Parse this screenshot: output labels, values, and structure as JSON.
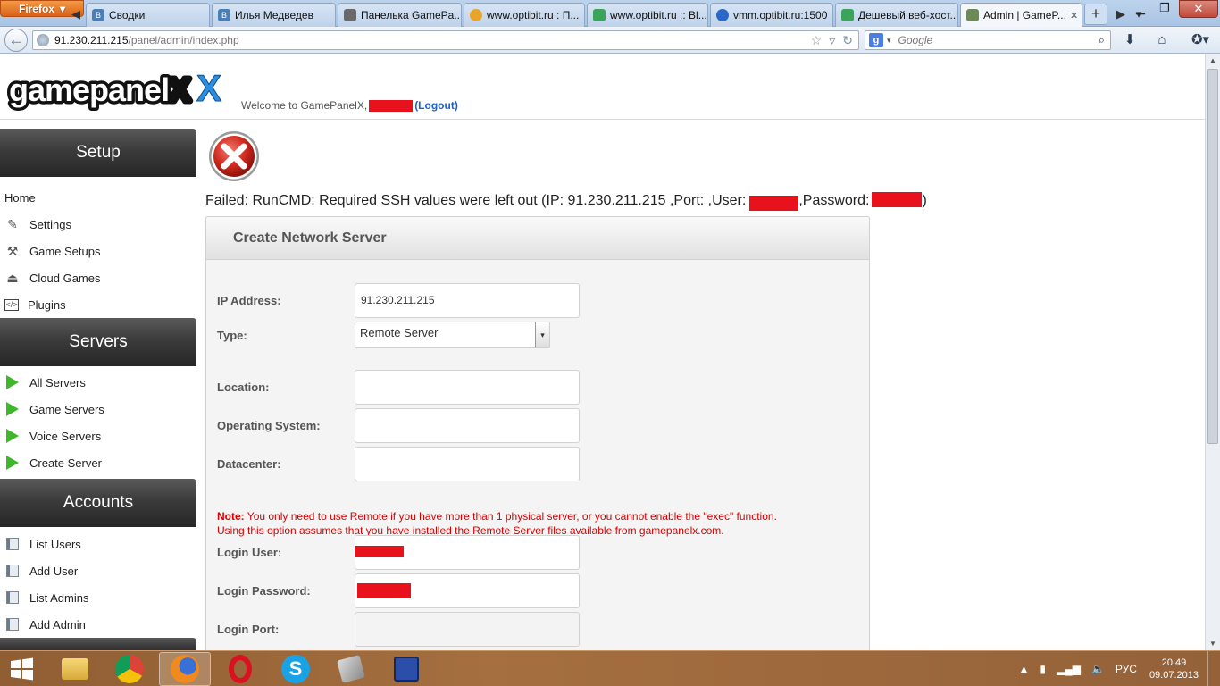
{
  "browser": {
    "app_button": "Firefox",
    "tabs": [
      {
        "label": "Сводки",
        "color": "#4b7eb5"
      },
      {
        "label": "Илья Медведев",
        "color": "#4b7eb5"
      },
      {
        "label": "Панелька GamePa...",
        "color": "#6a6a6a"
      },
      {
        "label": "www.optibit.ru : П...",
        "color": "#3a6bb0"
      },
      {
        "label": "www.optibit.ru :: Bl...",
        "color": "#3aa55a"
      },
      {
        "label": "vmm.optibit.ru:1500",
        "color": "#2a68c7"
      },
      {
        "label": "Дешевый веб-хост...",
        "color": "#3aa55a"
      },
      {
        "label": "Admin | GameP...",
        "color": "#6b8a57"
      }
    ],
    "url_host": "91.230.211.215",
    "url_path": "/panel/admin/index.php",
    "search_placeholder": "Google"
  },
  "header": {
    "logo_text": "gamepanelX",
    "welcome_text": "Welcome to GamePanelX,",
    "logout_label": "(Logout)"
  },
  "sidebar": {
    "sections": [
      {
        "title": "Setup",
        "items": [
          {
            "label": "Home",
            "icon": "none"
          },
          {
            "label": "Settings",
            "icon": "settings-icon"
          },
          {
            "label": "Game Setups",
            "icon": "tools-icon"
          },
          {
            "label": "Cloud Games",
            "icon": "cloud-drive-icon"
          },
          {
            "label": "Plugins",
            "icon": "code-icon"
          }
        ]
      },
      {
        "title": "Servers",
        "items": [
          {
            "label": "All Servers",
            "icon": "play-icon"
          },
          {
            "label": "Game Servers",
            "icon": "play-icon"
          },
          {
            "label": "Voice Servers",
            "icon": "play-icon"
          },
          {
            "label": "Create Server",
            "icon": "play-icon"
          }
        ]
      },
      {
        "title": "Accounts",
        "items": [
          {
            "label": "List Users",
            "icon": "book-icon"
          },
          {
            "label": "Add User",
            "icon": "book-icon"
          },
          {
            "label": "List Admins",
            "icon": "book-icon"
          },
          {
            "label": "Add Admin",
            "icon": "book-icon"
          }
        ]
      }
    ]
  },
  "error": {
    "msg_part1": "Failed: RunCMD: Required SSH values were left out (IP: 91.230.211.215 ,Port: ,User:",
    "msg_part2": ",Password:",
    "msg_part3": ")"
  },
  "form": {
    "title": "Create Network Server",
    "ip_label": "IP Address:",
    "ip_value": "91.230.211.215",
    "type_label": "Type:",
    "type_value": "Remote Server",
    "location_label": "Location:",
    "os_label": "Operating System:",
    "datacenter_label": "Datacenter:",
    "note_bold": "Note:",
    "note_line1": " You only need to use Remote if you have more than 1 physical server, or you cannot enable the \"exec\" function.",
    "note_line2": "Using this option assumes that you have installed the Remote Server files available from gamepanelx.com.",
    "login_user_label": "Login User:",
    "login_password_label": "Login Password:",
    "login_port_label": "Login Port:"
  },
  "taskbar": {
    "lang": "РУС",
    "time": "20:49",
    "date": "09.07.2013"
  }
}
